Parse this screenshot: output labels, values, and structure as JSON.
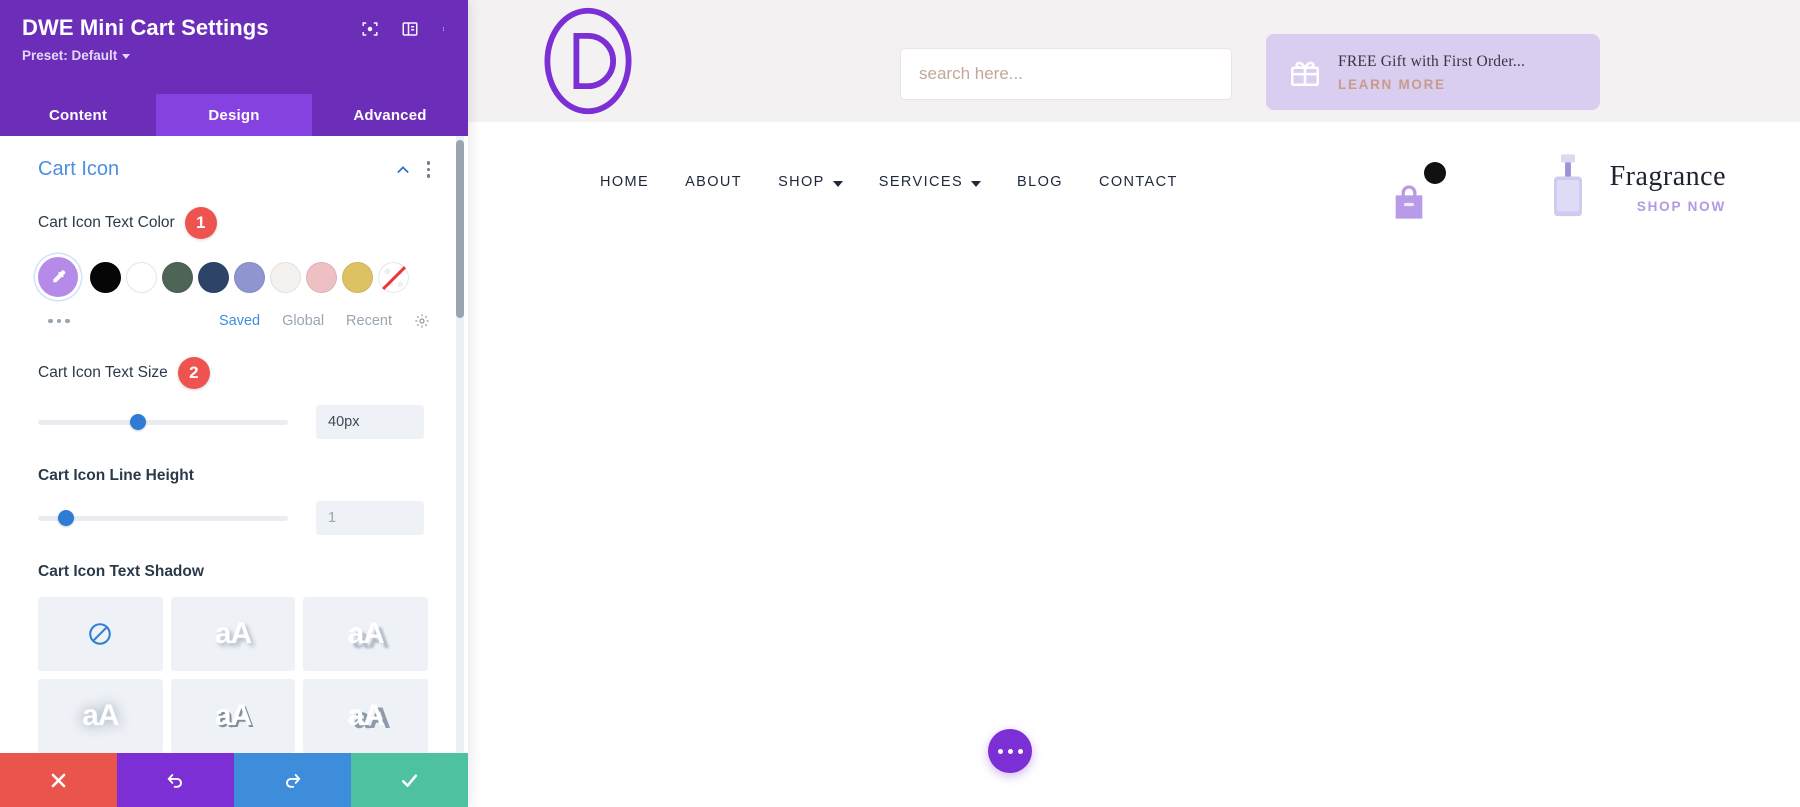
{
  "panel": {
    "title": "DWE Mini Cart Settings",
    "preset_label": "Preset: Default",
    "header_icons": [
      {
        "name": "focus-icon"
      },
      {
        "name": "layout-panel-icon"
      },
      {
        "name": "kebab-menu-icon"
      }
    ],
    "tabs": [
      {
        "label": "Content",
        "active": false
      },
      {
        "label": "Design",
        "active": true
      },
      {
        "label": "Advanced",
        "active": false
      }
    ],
    "section": {
      "title": "Cart Icon",
      "collapse_icon": "chevron-up-icon",
      "options_icon": "kebab-menu-icon"
    },
    "fields": {
      "text_color": {
        "label": "Cart Icon Text Color",
        "badge": "1",
        "swatches": [
          {
            "name": "color-picker",
            "color": "#b58ae8"
          },
          {
            "name": "swatch-black",
            "color": "#060606"
          },
          {
            "name": "swatch-white",
            "color": "#ffffff"
          },
          {
            "name": "swatch-green",
            "color": "#4d6457"
          },
          {
            "name": "swatch-navy",
            "color": "#2d4368"
          },
          {
            "name": "swatch-periwinkle",
            "color": "#8f95cf"
          },
          {
            "name": "swatch-offwhite",
            "color": "#f5f1ef"
          },
          {
            "name": "swatch-pink",
            "color": "#eec0c4"
          },
          {
            "name": "swatch-gold",
            "color": "#ddc263"
          },
          {
            "name": "swatch-none",
            "color": "transparent"
          }
        ],
        "more_icon": "ellipsis-icon",
        "links": [
          {
            "label": "Saved",
            "active": true
          },
          {
            "label": "Global",
            "active": false
          },
          {
            "label": "Recent",
            "active": false
          }
        ],
        "settings_icon": "gear-icon"
      },
      "text_size": {
        "label": "Cart Icon Text Size",
        "badge": "2",
        "value": "40px",
        "slider_percent": 40
      },
      "line_height": {
        "label": "Cart Icon Line Height",
        "value": "1",
        "slider_percent": 11
      },
      "text_shadow": {
        "label": "Cart Icon Text Shadow",
        "presets": [
          {
            "name": "shadow-none",
            "glyph": "",
            "style": "none"
          },
          {
            "name": "shadow-soft-down",
            "glyph": "aA",
            "style": "sh1"
          },
          {
            "name": "shadow-hard-down",
            "glyph": "aA",
            "style": "sh2"
          },
          {
            "name": "shadow-glow",
            "glyph": "aA",
            "style": "sh3"
          },
          {
            "name": "shadow-offset",
            "glyph": "aA",
            "style": "sh4"
          },
          {
            "name": "shadow-long",
            "glyph": "aA",
            "style": "sh5"
          }
        ]
      }
    },
    "footer": [
      {
        "name": "cancel-button",
        "icon": "close-icon",
        "color": "#e9554d"
      },
      {
        "name": "undo-button",
        "icon": "undo-icon",
        "color": "#7b2fd4"
      },
      {
        "name": "redo-button",
        "icon": "redo-icon",
        "color": "#3d8ddb"
      },
      {
        "name": "save-button",
        "icon": "check-icon",
        "color": "#4ec2a0"
      }
    ]
  },
  "site": {
    "logo_letter": "D",
    "search": {
      "placeholder": "search here...",
      "value": ""
    },
    "gift_banner": {
      "icon": "gift-icon",
      "headline": "FREE Gift with First Order...",
      "cta": "LEARN MORE"
    },
    "menu": [
      {
        "label": "HOME",
        "has_dropdown": false
      },
      {
        "label": "ABOUT",
        "has_dropdown": false
      },
      {
        "label": "SHOP",
        "has_dropdown": true
      },
      {
        "label": "SERVICES",
        "has_dropdown": true
      },
      {
        "label": "BLOG",
        "has_dropdown": false
      },
      {
        "label": "CONTACT",
        "has_dropdown": false
      }
    ],
    "cart": {
      "icon": "shopping-bag-icon",
      "badge_color": "#111111"
    },
    "promo": {
      "icon": "perfume-bottle-icon",
      "title": "Fragrance",
      "cta": "SHOP NOW"
    },
    "fab": {
      "icon": "ellipsis-icon",
      "color": "#7b2fd4"
    }
  },
  "colors": {
    "brand_purple": "#6c2eb9",
    "tab_active": "#8642e0",
    "accent_blue": "#4c8fe0",
    "badge_red": "#ef5350"
  }
}
